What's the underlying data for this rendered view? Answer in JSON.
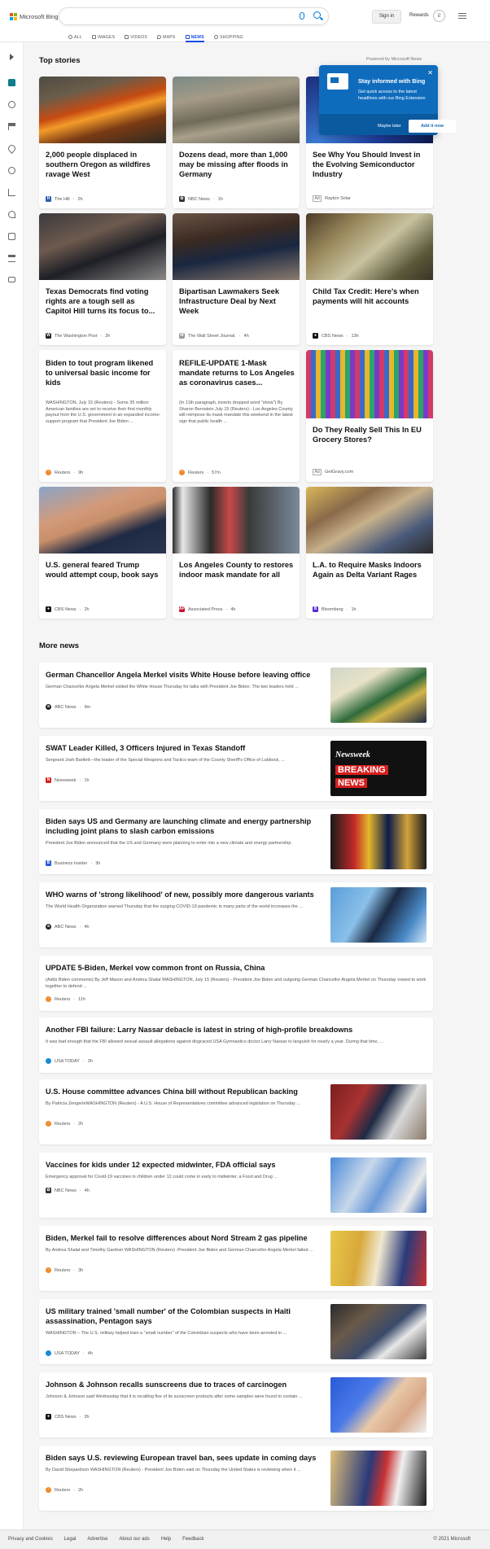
{
  "header": {
    "logo_text": "Microsoft Bing",
    "signin_label": "Sign in",
    "rewards_label": "Rewards",
    "tabs": [
      {
        "label": "ALL",
        "icon": "search-icon"
      },
      {
        "label": "IMAGES",
        "icon": "image-icon"
      },
      {
        "label": "VIDEOS",
        "icon": "video-icon"
      },
      {
        "label": "MAPS",
        "icon": "map-pin-icon"
      },
      {
        "label": "NEWS",
        "icon": "news-icon"
      },
      {
        "label": "SHOPPING",
        "icon": "shopping-tag-icon"
      }
    ],
    "active_tab": "NEWS"
  },
  "colors": {
    "accent": "#174ae4",
    "popup_bg": "#0f6cbd"
  },
  "top_stories": {
    "title": "Top stories",
    "powered_by": "Powered by Microsoft News",
    "cards": [
      {
        "title": "2,000 people displaced in southern Oregon as wildfires ravage West",
        "source": "The Hill",
        "time": "2h"
      },
      {
        "title": "Dozens dead, more than 1,000 may be missing after floods in Germany",
        "source": "NBC News",
        "time": "1h"
      },
      {
        "title": "See Why You Should Invest in the Evolving Semiconductor Industry",
        "source": "Rayton Solar",
        "ad": "Ad"
      },
      {
        "title": "Texas Democrats find voting rights are a tough sell as Capitol Hill turns its focus to...",
        "source": "The Washington Post",
        "time": "2h"
      },
      {
        "title": "Bipartisan Lawmakers Seek Infrastructure Deal by Next Week",
        "source": "The Wall Street Journal.",
        "time": "4h"
      },
      {
        "title": "Child Tax Credit: Here's when payments will hit accounts",
        "source": "CBS News",
        "time": "13h"
      },
      {
        "title": "Biden to tout program likened to universal basic income for kids",
        "snippet": "WASHINGTON, July 15 (Reuters) - Some 35 million American families are set to receive their first monthly payout from the U.S. government in an expanded income-support program that President Joe Biden ...",
        "source": "Reuters",
        "time": "9h"
      },
      {
        "title": "REFILE-UPDATE 1-Mask mandate returns to Los Angeles as coronavirus cases...",
        "snippet": "(In 11th paragraph, inserts dropped word \"show\") By Sharon Bernstein July 15 (Reuters) - Los Angeles County will reimpose its mask mandate this weekend in the latest sign that public health ...",
        "source": "Reuters",
        "time": "57m"
      },
      {
        "title": "Do They Really Sell This In EU Grocery Stores?",
        "source": "GetGravy.com",
        "ad": "Ad"
      },
      {
        "title": "U.S. general feared Trump would attempt coup, book says",
        "source": "CBS News",
        "time": "2h"
      },
      {
        "title": "Los Angeles County to restores indoor mask mandate for all",
        "source": "Associated Press",
        "time": "4h"
      },
      {
        "title": "L.A. to Require Masks Indoors Again as Delta Variant Rages",
        "source": "Bloomberg",
        "time": "1h"
      }
    ]
  },
  "popup": {
    "title": "Stay informed with Bing",
    "text": "Get quick access to the latest headlines with our Bing Extension",
    "later_label": "Maybe later",
    "add_label": "Add it now"
  },
  "more_news": {
    "title": "More news",
    "items": [
      {
        "title": "German Chancellor Angela Merkel visits White House before leaving office",
        "snippet": "German Chancellor Angela Merkel visited the White House Thursday for talks with President Joe Biden. The two leaders held ...",
        "source": "ABC News",
        "time": "9m"
      },
      {
        "title": "SWAT Leader Killed, 3 Officers Injured in Texas Standoff",
        "snippet": "Sergeant Josh Bartlett—the leader of the Special Weapons and Tactics team of the County Sheriff's Office of Lubbock, ...",
        "source": "Newsweek",
        "time": "1h",
        "image_text_1": "Newsweek",
        "image_text_2": "BREAKING",
        "image_text_3": "NEWS"
      },
      {
        "title": "Biden says US and Germany are launching climate and energy partnership including joint plans to slash carbon emissions",
        "snippet": "President Joe Biden announced that the US and Germany were planning to enter into a new climate and energy partnership.",
        "source": "Business Insider",
        "time": "3h"
      },
      {
        "title": "WHO warns of 'strong likelihood' of new, possibly more dangerous variants",
        "snippet": "The World Health Organization warned Thursday that the surging COVID-19 pandemic in many parts of the world increases the ...",
        "source": "ABC News",
        "time": "4h"
      },
      {
        "title": "UPDATE 5-Biden, Merkel vow common front on Russia, China",
        "snippet": "(Adds Biden comments) By Jeff Mason and Andrea Shalal WASHINGTON, July 15 (Reuters) - President Joe Biden and outgoing German Chancellor Angela Merkel on Thursday vowed to work together to defend ...",
        "source": "Reuters",
        "time": "11h"
      },
      {
        "title": "Another FBI failure: Larry Nassar debacle is latest in string of high-profile breakdowns",
        "snippet": "It was bad enough that the FBI allowed sexual assault allegations against disgraced USA Gymnastics doctor Larry Nassar to languish for nearly a year. During that time, ...",
        "source": "USA TODAY",
        "time": "3h"
      },
      {
        "title": "U.S. House committee advances China bill without Republican backing",
        "snippet": "By Patricia ZengerleWASHINGTON (Reuters) - A U.S. House of Representatives committee advanced legislation on Thursday ...",
        "source": "Reuters",
        "time": "2h"
      },
      {
        "title": "Vaccines for kids under 12 expected midwinter, FDA official says",
        "snippet": "Emergency approval for Covid-19 vaccines in children under 12 could come in early to midwinter, a Food and Drug ...",
        "source": "NBC News",
        "time": "4h"
      },
      {
        "title": "Biden, Merkel fail to resolve differences about Nord Stream 2 gas pipeline",
        "snippet": "By Andrea Shalal and Timothy Gardner WASHINGTON (Reuters) -President Joe Biden and German Chancellor Angela Merkel failed ...",
        "source": "Reuters",
        "time": "3h"
      },
      {
        "title": "US military trained 'small number' of the Colombian suspects in Haiti assassination, Pentagon says",
        "snippet": "WASHINGTON – The U.S. military helped train a \"small number\" of the Colombian suspects who have been arrested in ...",
        "source": "USA TODAY",
        "time": "4h"
      },
      {
        "title": "Johnson & Johnson recalls sunscreens due to traces of carcinogen",
        "snippet": "Johnson & Johnson said Wednesday that it is recalling five of its sunscreen products after some samples were found to contain ...",
        "source": "CBS News",
        "time": "2h"
      },
      {
        "title": "Biden says U.S. reviewing European travel ban, sees update in coming days",
        "snippet": "By David Shepardson WASHINGTON (Reuters) - President Joe Biden said on Thursday the United States is reviewing when it ...",
        "source": "Reuters",
        "time": "2h"
      }
    ]
  },
  "footer": {
    "links": [
      "Privacy and Cookies",
      "Legal",
      "Advertise",
      "About our ads",
      "Help",
      "Feedback"
    ],
    "copyright": "© 2021 Microsoft"
  }
}
